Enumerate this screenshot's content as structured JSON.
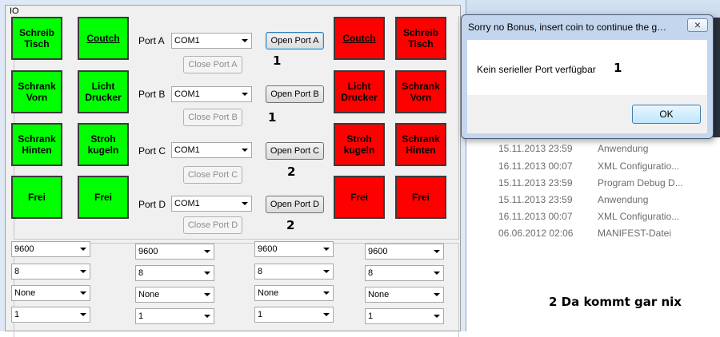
{
  "io_window": {
    "title": "IO",
    "tiles_left": [
      {
        "label": "Schreib\nTisch",
        "color": "#00ff00",
        "underline": false
      },
      {
        "label": "Coutch",
        "color": "#00ff00",
        "underline": true
      },
      {
        "label": "Schrank\nVorn",
        "color": "#00ff00",
        "underline": false
      },
      {
        "label": "Licht\nDrucker",
        "color": "#00ff00",
        "underline": false
      },
      {
        "label": "Schrank\nHinten",
        "color": "#00ff00",
        "underline": false
      },
      {
        "label": "Stroh\nkugeln",
        "color": "#00ff00",
        "underline": false
      },
      {
        "label": "Frei",
        "color": "#00ff00",
        "underline": false
      },
      {
        "label": "Frei",
        "color": "#00ff00",
        "underline": false
      }
    ],
    "tiles_right": [
      {
        "label": "Coutch",
        "color": "#ff0000",
        "underline": true
      },
      {
        "label": "Schreib\nTisch",
        "color": "#ff0000",
        "underline": false
      },
      {
        "label": "Licht\nDrucker",
        "color": "#ff0000",
        "underline": false
      },
      {
        "label": "Schrank\nVorn",
        "color": "#ff0000",
        "underline": false
      },
      {
        "label": "Stroh\nkugeln",
        "color": "#ff0000",
        "underline": false
      },
      {
        "label": "Schrank\nHinten",
        "color": "#ff0000",
        "underline": false
      },
      {
        "label": "Frei",
        "color": "#ff0000",
        "underline": false
      },
      {
        "label": "Frei",
        "color": "#ff0000",
        "underline": false
      }
    ],
    "ports": [
      {
        "label": "Port A",
        "selected": "COM1",
        "open_label": "Open Port A",
        "close_label": "Close Port A",
        "note": "1"
      },
      {
        "label": "Port B",
        "selected": "COM1",
        "open_label": "Open Port B",
        "close_label": "Close Port B",
        "note": "1"
      },
      {
        "label": "Port C",
        "selected": "COM1",
        "open_label": "Open Port C",
        "close_label": "Close Port C",
        "note": "2"
      },
      {
        "label": "Port D",
        "selected": "COM1",
        "open_label": "Open Port D",
        "close_label": "Close Port D",
        "note": "2"
      }
    ],
    "serial_settings": [
      {
        "baud": "9600",
        "databits": "8",
        "parity": "None",
        "stopbits": "1"
      },
      {
        "baud": "9600",
        "databits": "8",
        "parity": "None",
        "stopbits": "1"
      },
      {
        "baud": "9600",
        "databits": "8",
        "parity": "None",
        "stopbits": "1"
      },
      {
        "baud": "9600",
        "databits": "8",
        "parity": "None",
        "stopbits": "1"
      }
    ]
  },
  "dialog": {
    "title": "Sorry no Bonus, insert coin to continue the ga...",
    "close_glyph": "×",
    "message": "Kein serieller Port verfügbar",
    "note": "1",
    "ok_label": "OK"
  },
  "background_files": [
    {
      "date": "15.11.2013 23:59",
      "type": "Anwendung"
    },
    {
      "date": "16.11.2013 00:07",
      "type": "XML Configuratio..."
    },
    {
      "date": "15.11.2013 23:59",
      "type": "Program Debug D..."
    },
    {
      "date": "15.11.2013 23:59",
      "type": "Anwendung"
    },
    {
      "date": "16.11.2013 00:07",
      "type": "XML Configuratio..."
    },
    {
      "date": "06.06.2012 02:06",
      "type": "MANIFEST-Datei"
    }
  ],
  "annotation_bottom": "2 Da kommt gar nix"
}
